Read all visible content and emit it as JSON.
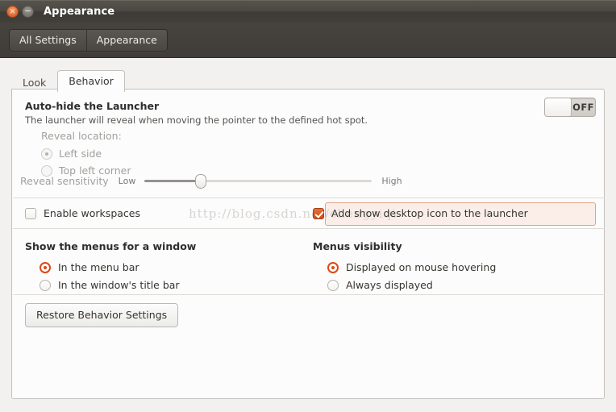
{
  "window": {
    "title": "Appearance",
    "close_glyph": "×",
    "minimize_glyph": "−"
  },
  "toolbar": {
    "all_settings_label": "All Settings",
    "appearance_label": "Appearance"
  },
  "tabs": [
    {
      "label": "Look",
      "active": false
    },
    {
      "label": "Behavior",
      "active": true
    }
  ],
  "autohide": {
    "title": "Auto-hide the Launcher",
    "description": "The launcher will reveal when moving the pointer to the defined hot spot.",
    "toggle_state": "OFF",
    "reveal_location_label": "Reveal location:",
    "options": [
      {
        "label": "Left side",
        "selected": true
      },
      {
        "label": "Top left corner",
        "selected": false
      }
    ],
    "sensitivity_label": "Reveal sensitivity",
    "sensitivity_low": "Low",
    "sensitivity_high": "High",
    "sensitivity_value": 25
  },
  "workspaces": {
    "enable_label": "Enable workspaces",
    "enable_checked": false,
    "desktop_icon_label": "Add show desktop icon to the launcher",
    "desktop_icon_checked": true
  },
  "menus": {
    "window_menus_title": "Show the menus for a window",
    "window_menus_options": [
      {
        "label": "In the menu bar",
        "selected": true
      },
      {
        "label": "In the window's title bar",
        "selected": false
      }
    ],
    "visibility_title": "Menus visibility",
    "visibility_options": [
      {
        "label": "Displayed on mouse hovering",
        "selected": true
      },
      {
        "label": "Always displayed",
        "selected": false
      }
    ]
  },
  "footer": {
    "restore_label": "Restore Behavior Settings"
  },
  "watermark": {
    "text": "http://blog.csdn.net/chengyiqi"
  },
  "colors": {
    "accent": "#dd4814",
    "titlebar_dark": "#423f3a",
    "panel_bg": "#fcfcfc",
    "highlight_border": "#e3a084",
    "highlight_bg": "#fbeee8"
  }
}
